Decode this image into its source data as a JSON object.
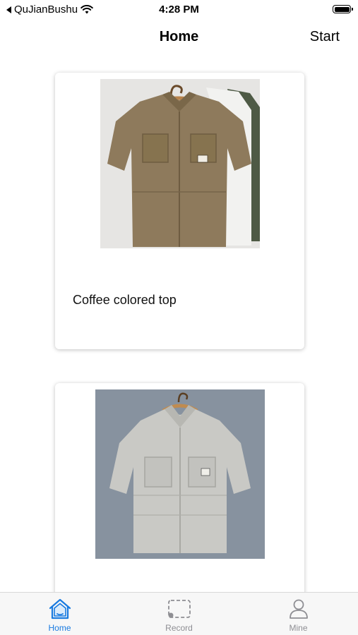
{
  "status_bar": {
    "back_app": "QuJianBushu",
    "time": "4:28 PM"
  },
  "nav": {
    "title": "Home",
    "start_label": "Start"
  },
  "cards": [
    {
      "title": "Coffee colored top",
      "image_icon": "shirt-khaki-image"
    },
    {
      "title": "",
      "image_icon": "shirt-gray-image"
    }
  ],
  "tabs": [
    {
      "label": "Home",
      "icon": "home-icon",
      "active": true
    },
    {
      "label": "Record",
      "icon": "scan-icon",
      "active": false
    },
    {
      "label": "Mine",
      "icon": "person-icon",
      "active": false
    }
  ],
  "colors": {
    "accent": "#1a7be0",
    "inactive_tab": "#8e8e93"
  }
}
